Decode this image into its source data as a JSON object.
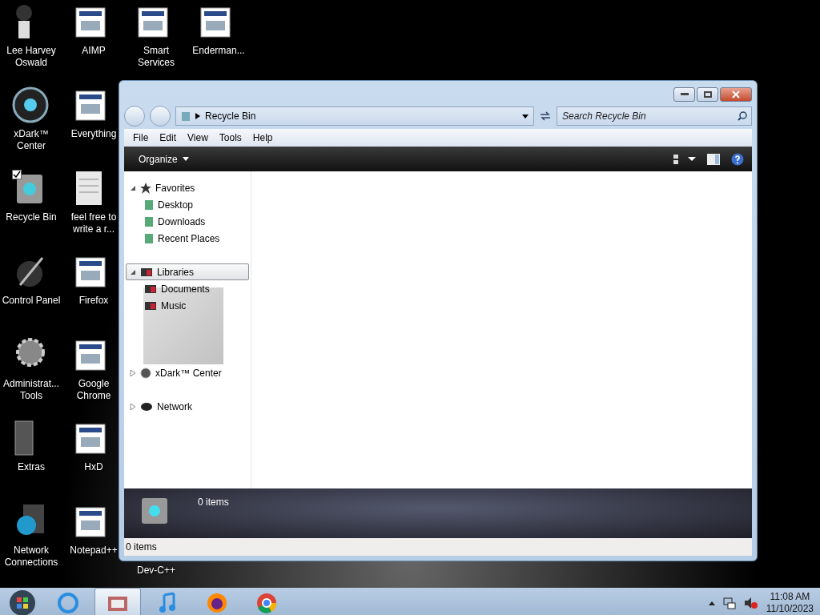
{
  "desktop": {
    "columns": [
      [
        {
          "label": "Lee Harvey Oswald",
          "kind": "figure"
        },
        {
          "label": "xDark™ Center",
          "kind": "orb"
        },
        {
          "label": "Recycle Bin",
          "kind": "bin",
          "checked": true
        },
        {
          "label": "Control Panel",
          "kind": "tool"
        },
        {
          "label": "Administrat... Tools",
          "kind": "gear"
        },
        {
          "label": "Extras",
          "kind": "folder"
        },
        {
          "label": "Network Connections",
          "kind": "globe"
        }
      ],
      [
        {
          "label": "AIMP",
          "kind": "app"
        },
        {
          "label": "Everything",
          "kind": "app"
        },
        {
          "label": "feel free to write a r...",
          "kind": "doc"
        },
        {
          "label": "Firefox",
          "kind": "app"
        },
        {
          "label": "Google Chrome",
          "kind": "app"
        },
        {
          "label": "HxD",
          "kind": "app"
        },
        {
          "label": "Notepad++",
          "kind": "app"
        }
      ],
      [
        {
          "label": "Smart Services",
          "kind": "app"
        },
        {
          "label": "Dev-C++",
          "kind": "hidden"
        }
      ],
      [
        {
          "label": "Enderman...",
          "kind": "app"
        }
      ]
    ]
  },
  "window": {
    "address": "Recycle Bin",
    "search": {
      "placeholder": "Search Recycle Bin"
    },
    "menu": [
      "File",
      "Edit",
      "View",
      "Tools",
      "Help"
    ],
    "toolbar": {
      "organize": "Organize"
    },
    "tree": [
      {
        "label": "Favorites",
        "kind": "star",
        "expanded": true,
        "selected": false,
        "children": [
          {
            "label": "Desktop",
            "kind": "place"
          },
          {
            "label": "Downloads",
            "kind": "place"
          },
          {
            "label": "Recent Places",
            "kind": "place"
          }
        ]
      },
      {
        "label": "Libraries",
        "kind": "library",
        "expanded": true,
        "selected": true,
        "children": [
          {
            "label": "Documents",
            "kind": "library"
          },
          {
            "label": "Music",
            "kind": "library"
          }
        ]
      },
      {
        "label": "xDark™ Center",
        "kind": "orb",
        "expanded": false,
        "selected": false
      },
      {
        "label": "Network",
        "kind": "network",
        "expanded": false,
        "selected": false
      }
    ],
    "details": {
      "count": "0 items"
    },
    "status_bar": "0 items"
  },
  "taskbar": {
    "clock": {
      "time": "11:08 AM",
      "date": "11/10/2023"
    },
    "apps": [
      {
        "kind": "ie",
        "selected": false
      },
      {
        "kind": "library",
        "selected": true
      },
      {
        "kind": "music",
        "selected": false
      },
      {
        "kind": "firefox",
        "selected": false
      },
      {
        "kind": "chrome",
        "selected": false
      }
    ]
  }
}
